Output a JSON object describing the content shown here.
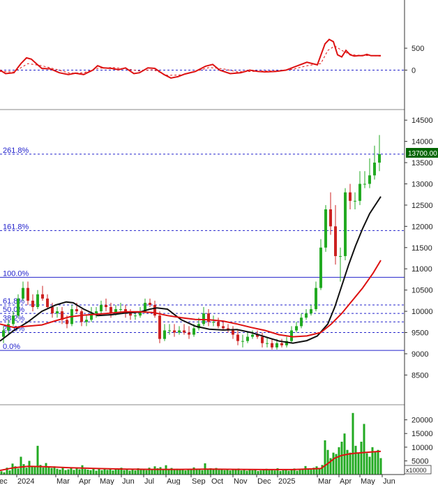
{
  "colors": {
    "up": "#22aa22",
    "down": "#cc2222",
    "ma_fast": "#111111",
    "ma_slow": "#dd1111",
    "oscillator": "#dd1111",
    "fib": "#2222cc",
    "price_tag_bg": "#006600"
  },
  "price_tag": "13700.00",
  "volume_unit": "x10000",
  "x_labels": [
    "ec",
    "2024",
    "Mar",
    "Apr",
    "May",
    "Jun",
    "Jul",
    "Aug",
    "Sep",
    "Oct",
    "Nov",
    "Dec",
    "2025",
    "Mar",
    "Apr",
    "May",
    "Jun"
  ],
  "chart_data": [
    {
      "type": "line",
      "panel": "oscillator",
      "ylim": [
        -900,
        1600
      ],
      "yticks": [
        "500",
        "0"
      ],
      "series": [
        {
          "style": "solid",
          "x": [
            0,
            8,
            20,
            30,
            38,
            45,
            52,
            60,
            72,
            85,
            98,
            108,
            120,
            133,
            140,
            148,
            160,
            170,
            180,
            192,
            200,
            212,
            222,
            235,
            245,
            255,
            265,
            280,
            295,
            305,
            315,
            330,
            345,
            358,
            370,
            380,
            395,
            410,
            425,
            440,
            455,
            466,
            472,
            478,
            484,
            490,
            496,
            502,
            508,
            514,
            520,
            526,
            532,
            538,
            546
          ],
          "y": [
            0,
            -80,
            -60,
            150,
            280,
            250,
            150,
            40,
            30,
            -60,
            -100,
            -70,
            -100,
            0,
            100,
            50,
            40,
            10,
            50,
            -80,
            -60,
            50,
            40,
            -100,
            -180,
            -150,
            -90,
            -30,
            90,
            130,
            0,
            -80,
            -60,
            0,
            -30,
            -40,
            -30,
            0,
            90,
            180,
            120,
            600,
            700,
            650,
            350,
            300,
            450,
            350,
            320,
            330,
            330,
            360,
            330,
            330,
            330
          ]
        },
        {
          "style": "dashed",
          "x": [
            0,
            20,
            40,
            60,
            80,
            100,
            120,
            140,
            160,
            180,
            200,
            220,
            240,
            260,
            280,
            300,
            320,
            340,
            360,
            380,
            400,
            420,
            440,
            460,
            470,
            480,
            490,
            500,
            510,
            520,
            530,
            546
          ],
          "y": [
            -30,
            -40,
            150,
            100,
            20,
            -70,
            -60,
            40,
            60,
            30,
            -20,
            10,
            -120,
            -110,
            -30,
            60,
            30,
            -40,
            -30,
            -20,
            -20,
            20,
            100,
            150,
            450,
            550,
            450,
            370,
            340,
            340,
            330,
            320
          ]
        }
      ]
    },
    {
      "type": "line",
      "panel": "price",
      "ylim": [
        7800,
        14700
      ],
      "yticks": [
        "14500",
        "14000",
        "13500",
        "13000",
        "12500",
        "12000",
        "11500",
        "11000",
        "10500",
        "10000",
        "9500",
        "9000",
        "8500"
      ],
      "fibonacci": [
        {
          "label": "261.8%",
          "value": 13700
        },
        {
          "label": "161.8%",
          "value": 11900
        },
        {
          "label": "100.0%",
          "value": 10800
        },
        {
          "label": "61.8%",
          "value": 10150
        },
        {
          "label": "50.0%",
          "value": 9950
        },
        {
          "label": "38.2%",
          "value": 9750
        },
        {
          "label": "23.6%",
          "value": 9500
        },
        {
          "label": "0.0%",
          "value": 9080
        }
      ],
      "candles": {
        "x": [
          5,
          12,
          19,
          26,
          33,
          40,
          47,
          54,
          61,
          68,
          75,
          82,
          89,
          96,
          103,
          110,
          117,
          124,
          131,
          138,
          145,
          152,
          159,
          166,
          173,
          180,
          187,
          194,
          201,
          208,
          215,
          222,
          229,
          236,
          243,
          250,
          257,
          264,
          271,
          278,
          285,
          292,
          299,
          306,
          313,
          320,
          327,
          334,
          341,
          348,
          355,
          362,
          369,
          376,
          383,
          390,
          397,
          404,
          411,
          418,
          425,
          432,
          439,
          446,
          453,
          460,
          467,
          474,
          481,
          488,
          495,
          502,
          509,
          516,
          523,
          530,
          537,
          544
        ],
        "open": [
          9400,
          9550,
          9700,
          9900,
          10300,
          10550,
          10250,
          10100,
          10400,
          10300,
          10100,
          9950,
          10000,
          9800,
          9700,
          10050,
          10000,
          9750,
          9800,
          9950,
          10000,
          10150,
          10100,
          9950,
          10050,
          10050,
          9950,
          9900,
          9900,
          10000,
          10200,
          10150,
          9900,
          9350,
          9550,
          9550,
          9500,
          9550,
          9500,
          9450,
          9600,
          9700,
          9950,
          9750,
          9750,
          9650,
          9600,
          9550,
          9450,
          9300,
          9300,
          9400,
          9450,
          9400,
          9250,
          9250,
          9150,
          9250,
          9200,
          9300,
          9550,
          9650,
          9850,
          9950,
          10050,
          10550,
          11500,
          12400,
          12000,
          11300,
          11300,
          12800,
          12600,
          12600,
          13000,
          13000,
          13200,
          13500
        ],
        "close": [
          9550,
          9700,
          9900,
          10300,
          10550,
          10250,
          10100,
          10400,
          10300,
          10100,
          9950,
          10000,
          9800,
          9700,
          10050,
          10000,
          9750,
          9800,
          9950,
          10000,
          10150,
          10100,
          9950,
          10050,
          10050,
          9950,
          9900,
          9900,
          10000,
          10200,
          10150,
          9900,
          9350,
          9550,
          9550,
          9500,
          9550,
          9500,
          9450,
          9600,
          9700,
          9950,
          9750,
          9750,
          9650,
          9600,
          9550,
          9450,
          9300,
          9300,
          9400,
          9450,
          9400,
          9250,
          9250,
          9150,
          9250,
          9200,
          9300,
          9550,
          9650,
          9850,
          9950,
          10050,
          10550,
          11500,
          12400,
          12000,
          11300,
          11300,
          12800,
          12600,
          12600,
          13000,
          13000,
          13200,
          13500,
          13700
        ],
        "high": [
          9650,
          9800,
          10000,
          10400,
          10700,
          10700,
          10400,
          10500,
          10600,
          10400,
          10200,
          10100,
          10100,
          9900,
          10150,
          10200,
          10050,
          9900,
          10100,
          10100,
          10250,
          10300,
          10200,
          10150,
          10200,
          10150,
          10050,
          10000,
          10100,
          10300,
          10300,
          10250,
          10000,
          9700,
          9700,
          9700,
          9650,
          9700,
          9650,
          9700,
          9850,
          10100,
          10050,
          9900,
          9850,
          9750,
          9700,
          9650,
          9550,
          9450,
          9500,
          9550,
          9550,
          9500,
          9400,
          9350,
          9350,
          9350,
          9400,
          9650,
          9750,
          9950,
          10050,
          10150,
          10700,
          11700,
          12500,
          12800,
          12500,
          11500,
          12900,
          13000,
          12800,
          13300,
          13300,
          13600,
          13900,
          14150
        ],
        "low": [
          9250,
          9450,
          9650,
          9850,
          10250,
          10150,
          10000,
          10050,
          10250,
          10050,
          9850,
          9850,
          9700,
          9600,
          9650,
          9950,
          9650,
          9650,
          9750,
          9850,
          9950,
          10000,
          9850,
          9900,
          9950,
          9850,
          9800,
          9800,
          9850,
          9950,
          10100,
          9850,
          9250,
          9300,
          9450,
          9400,
          9450,
          9450,
          9350,
          9400,
          9550,
          9650,
          9650,
          9650,
          9600,
          9550,
          9500,
          9350,
          9200,
          9150,
          9250,
          9350,
          9350,
          9150,
          9150,
          9100,
          9100,
          9150,
          9150,
          9250,
          9500,
          9600,
          9800,
          9900,
          10000,
          10500,
          11400,
          11800,
          11100,
          10700,
          11200,
          12400,
          12400,
          12500,
          12900,
          12900,
          13100,
          13300
        ]
      },
      "series": [
        {
          "name": "MA fast",
          "x": [
            0,
            20,
            40,
            60,
            80,
            95,
            105,
            120,
            140,
            160,
            180,
            200,
            215,
            225,
            240,
            260,
            280,
            300,
            320,
            340,
            360,
            380,
            400,
            420,
            440,
            455,
            470,
            480,
            490,
            500,
            510,
            520,
            530,
            546
          ],
          "y": [
            9300,
            9550,
            9750,
            10000,
            10150,
            10220,
            10200,
            10050,
            9900,
            9920,
            9960,
            9980,
            10050,
            10080,
            10050,
            9800,
            9650,
            9580,
            9560,
            9570,
            9500,
            9400,
            9300,
            9250,
            9310,
            9420,
            9700,
            10100,
            10600,
            11100,
            11550,
            11950,
            12300,
            12700
          ]
        },
        {
          "name": "MA slow",
          "x": [
            0,
            20,
            40,
            60,
            80,
            100,
            120,
            140,
            160,
            180,
            200,
            220,
            240,
            260,
            280,
            300,
            320,
            340,
            360,
            380,
            400,
            420,
            440,
            460,
            475,
            490,
            505,
            520,
            535,
            546
          ],
          "y": [
            9700,
            9620,
            9650,
            9680,
            9780,
            9870,
            9910,
            9930,
            9960,
            9990,
            9990,
            9970,
            9900,
            9850,
            9810,
            9800,
            9770,
            9700,
            9620,
            9550,
            9450,
            9400,
            9420,
            9500,
            9700,
            9950,
            10250,
            10550,
            10900,
            11200
          ]
        }
      ]
    },
    {
      "type": "bar",
      "panel": "volume",
      "ylim": [
        0,
        25000
      ],
      "yticks": [
        "20000",
        "15000",
        "10000",
        "5000"
      ],
      "x": [
        2,
        6,
        10,
        14,
        18,
        22,
        26,
        30,
        34,
        38,
        42,
        46,
        50,
        54,
        58,
        62,
        66,
        70,
        74,
        78,
        82,
        86,
        90,
        94,
        98,
        102,
        106,
        110,
        114,
        118,
        122,
        126,
        130,
        134,
        138,
        142,
        146,
        150,
        154,
        158,
        162,
        166,
        170,
        174,
        178,
        182,
        186,
        190,
        194,
        198,
        202,
        206,
        210,
        214,
        218,
        222,
        226,
        230,
        234,
        238,
        242,
        246,
        250,
        254,
        258,
        262,
        266,
        270,
        274,
        278,
        282,
        286,
        290,
        294,
        298,
        302,
        306,
        310,
        314,
        318,
        322,
        326,
        330,
        334,
        338,
        342,
        346,
        350,
        354,
        358,
        362,
        366,
        370,
        374,
        378,
        382,
        386,
        390,
        394,
        398,
        402,
        406,
        410,
        414,
        418,
        422,
        426,
        430,
        434,
        438,
        442,
        446,
        450,
        454,
        458,
        462,
        466,
        470,
        474,
        478,
        482,
        486,
        490,
        494,
        498,
        502,
        506,
        510,
        514,
        518,
        522,
        526,
        530,
        534,
        538,
        542,
        546
      ],
      "values": [
        1200,
        800,
        2500,
        1500,
        4000,
        3000,
        2200,
        6500,
        3800,
        2500,
        5000,
        3200,
        2800,
        10500,
        3500,
        2600,
        4200,
        2800,
        2400,
        3000,
        2100,
        1800,
        2400,
        1600,
        1900,
        2300,
        1700,
        2600,
        1900,
        3400,
        2000,
        1800,
        1600,
        2200,
        1400,
        2400,
        1600,
        2000,
        1700,
        2300,
        1500,
        1900,
        1800,
        2500,
        1600,
        2100,
        1400,
        1800,
        1500,
        2300,
        1700,
        2000,
        1600,
        2500,
        1900,
        3000,
        2300,
        2700,
        1900,
        3400,
        1800,
        2400,
        1700,
        2100,
        1900,
        1700,
        1500,
        2000,
        1700,
        2600,
        1800,
        2100,
        1600,
        4100,
        1900,
        2300,
        1800,
        2400,
        1700,
        2000,
        1600,
        1800,
        1500,
        1900,
        1700,
        2200,
        1500,
        1800,
        1400,
        2000,
        1600,
        1800,
        1300,
        1500,
        1700,
        2100,
        1600,
        1800,
        1500,
        2300,
        1300,
        1600,
        1800,
        1400,
        1700,
        2200,
        1400,
        1700,
        2000,
        3100,
        1900,
        1800,
        2500,
        3000,
        2200,
        3500,
        12500,
        9000,
        6000,
        8000,
        7500,
        10000,
        12000,
        15000,
        9000,
        8000,
        22500,
        10500,
        8000,
        12000,
        18500,
        7800,
        6500,
        10000,
        8500,
        9000,
        6000
      ],
      "series": [
        {
          "name": "MA",
          "x": [
            0,
            20,
            40,
            60,
            80,
            100,
            140,
            180,
            220,
            260,
            300,
            340,
            380,
            420,
            460,
            470,
            480,
            490,
            500,
            510,
            520,
            530,
            546
          ],
          "y": [
            1500,
            2500,
            3000,
            2900,
            2700,
            2500,
            2200,
            2000,
            1900,
            1900,
            2000,
            1900,
            1800,
            1800,
            2200,
            4000,
            6000,
            7000,
            7500,
            7800,
            8000,
            8200,
            8500
          ]
        }
      ]
    }
  ]
}
